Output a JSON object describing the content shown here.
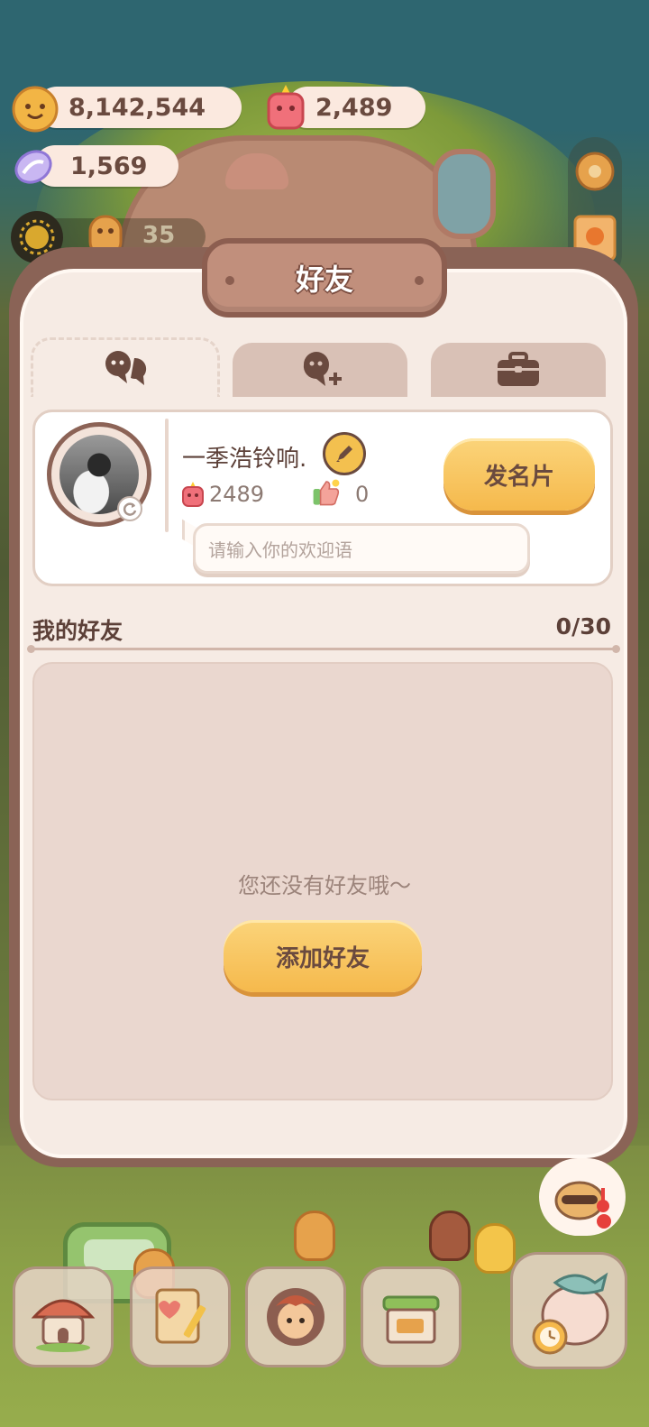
{
  "resources": {
    "coins": "8,142,544",
    "candles": "2,489",
    "candies": "1,569",
    "level": "35"
  },
  "dialog": {
    "title": "好友",
    "tabs": [
      {
        "name": "friends-list",
        "icon": "friends-icon",
        "active": true
      },
      {
        "name": "add-friend",
        "icon": "add-user-icon",
        "active": false
      },
      {
        "name": "inventory",
        "icon": "briefcase-icon",
        "active": false
      }
    ]
  },
  "profile": {
    "name": "一季浩铃响.",
    "candles": "2489",
    "likes": "0",
    "greeting_placeholder": "请输入你的欢迎语",
    "card_button": "发名片"
  },
  "friends": {
    "heading": "我的好友",
    "count": "0/30",
    "empty_message": "您还没有好友哦～",
    "add_button": "添加好友"
  },
  "colors": {
    "accent_button": "#f5b94c",
    "panel": "#f6ebe4",
    "frame": "#8a6356",
    "text_dark": "#5c4038"
  }
}
